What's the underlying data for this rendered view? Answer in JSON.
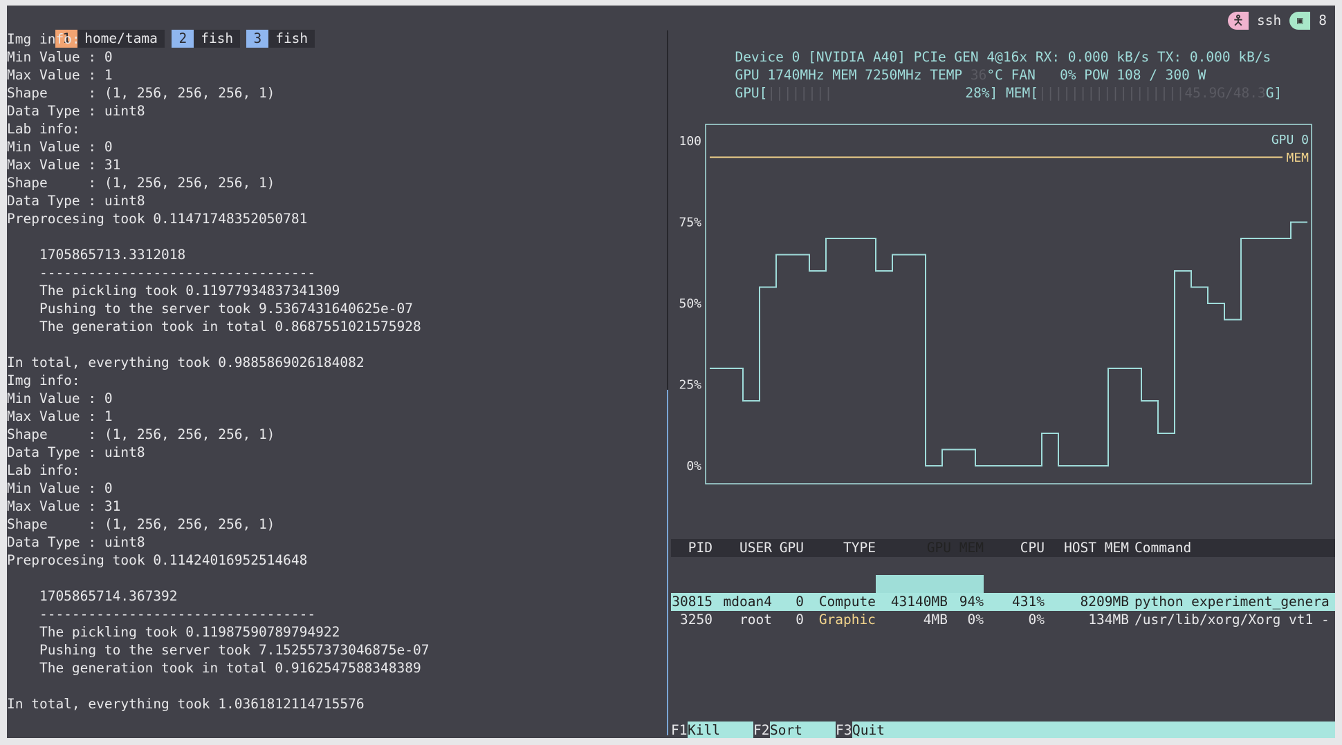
{
  "tabs": [
    {
      "num": "1",
      "name": "home/tama",
      "color": "#f2a472"
    },
    {
      "num": "2",
      "name": "fish",
      "color": "#8fb6ef"
    },
    {
      "num": "3",
      "name": "fish",
      "color": "#8fb6ef"
    }
  ],
  "status": {
    "host": "ssh",
    "session": "8"
  },
  "left_lines": [
    "Img info:",
    "Min Value : 0",
    "Max Value : 1",
    "Shape     : (1, 256, 256, 256, 1)",
    "Data Type : uint8",
    "Lab info:",
    "Min Value : 0",
    "Max Value : 31",
    "Shape     : (1, 256, 256, 256, 1)",
    "Data Type : uint8",
    "Preprocesing took 0.11471748352050781",
    "",
    "    1705865713.3312018",
    "    ----------------------------------",
    "    The pickling took 0.11977934837341309",
    "    Pushing to the server took 9.5367431640625e-07",
    "    The generation took in total 0.8687551021575928",
    "",
    "In total, everything took 0.9885869026184082",
    "Img info:",
    "Min Value : 0",
    "Max Value : 1",
    "Shape     : (1, 256, 256, 256, 1)",
    "Data Type : uint8",
    "Lab info:",
    "Min Value : 0",
    "Max Value : 31",
    "Shape     : (1, 256, 256, 256, 1)",
    "Data Type : uint8",
    "Preprocesing took 0.11424016952514648",
    "",
    "    1705865714.367392",
    "    ----------------------------------",
    "    The pickling took 0.11987590789794922",
    "    Pushing to the server took 7.152557373046875e-07",
    "    The generation took in total 0.9162547588348389",
    "",
    "In total, everything took 1.0361812114715576"
  ],
  "nvtop": {
    "device_line": "Device 0 [NVIDIA A40] PCIe GEN 4@16x RX: 0.000 kB/s TX: 0.000 kB/s",
    "clock_line_a": "GPU 1740MHz MEM 7250MHz TEMP ",
    "temp_value": "36",
    "clock_line_b": "°C FAN   0% POW 108 / 300 W",
    "gpu_bar_label": "GPU[",
    "gpu_bar_fill": "||||||||",
    "gpu_bar_pct": "28%]",
    "mem_bar_label": " MEM[",
    "mem_bar_fill": "||||||||||||||||||45.9G/48.3",
    "mem_bar_end": "G]"
  },
  "chart_data": {
    "type": "line",
    "ylim": [
      0,
      100
    ],
    "y_ticks": [
      "0%",
      "25%",
      "50%",
      "75%",
      "100"
    ],
    "legend": [
      "GPU 0",
      "MEM"
    ],
    "series": [
      {
        "name": "GPU 0",
        "color": "#9fdcda",
        "step": true,
        "values": [
          30,
          30,
          20,
          55,
          65,
          65,
          60,
          70,
          70,
          70,
          60,
          65,
          65,
          0,
          5,
          5,
          0,
          0,
          0,
          0,
          10,
          0,
          0,
          0,
          30,
          30,
          20,
          10,
          60,
          55,
          50,
          45,
          70,
          70,
          70,
          75
        ]
      },
      {
        "name": "MEM",
        "color": "#f2d48c",
        "step": false,
        "values": [
          95,
          95
        ]
      }
    ]
  },
  "processes": {
    "headers": [
      "PID",
      "USER",
      "GPU",
      "TYPE",
      "GPU MEM",
      "CPU",
      "HOST MEM",
      "Command"
    ],
    "rows": [
      {
        "pid": "30815",
        "user": "mdoan4",
        "gpu": "0",
        "type": "Compute",
        "gmem": "43140MB",
        "gpct": "94%",
        "cpu": "431%",
        "hmem": "8209MB",
        "cmd": "python experiment_genera"
      },
      {
        "pid": "3250",
        "user": "root",
        "gpu": "0",
        "type": "Graphic",
        "gmem": "4MB",
        "gpct": "0%",
        "cpu": "0%",
        "hmem": "134MB",
        "cmd": "/usr/lib/xorg/Xorg vt1 -"
      }
    ]
  },
  "fnkeys": [
    {
      "key": "F1",
      "label": "Kill"
    },
    {
      "key": "F2",
      "label": "Sort"
    },
    {
      "key": "F3",
      "label": "Quit"
    }
  ]
}
